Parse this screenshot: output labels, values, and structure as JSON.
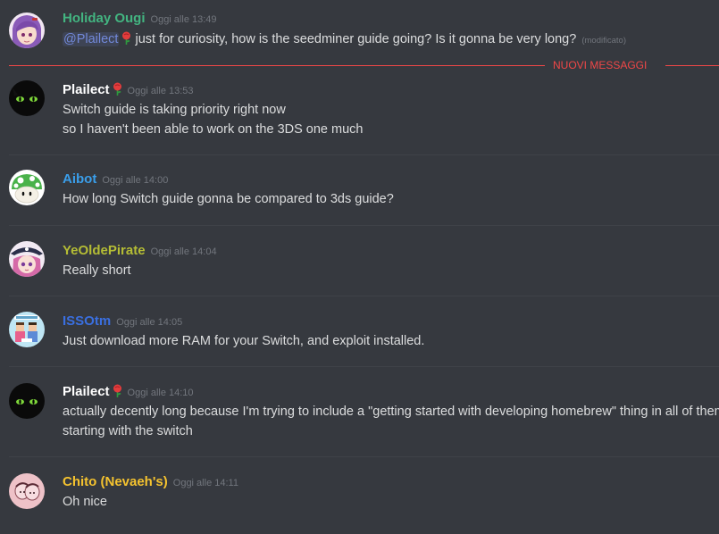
{
  "new_messages_label": "NUOVI MESSAGGI",
  "colors": {
    "background": "#36393f",
    "text": "#dcddde",
    "timestamp": "#72767d",
    "mention": "#7289da",
    "new_messages": "#f04747"
  },
  "messages": [
    {
      "author": "Holiday Ougi",
      "author_color": "#43b581",
      "timestamp": "Oggi alle 13:49",
      "avatar_icon": "purple-hair-anime-girl-avatar",
      "mention": "@Plailect",
      "mention_badge_icon": "rose-icon",
      "text": "just for curiosity, how is the seedminer guide going? Is it gonna  be very long?",
      "edited": "(modificato)"
    },
    {
      "author": "Plailect",
      "author_color": "#ffffff",
      "author_badge_icon": "rose-icon",
      "timestamp": "Oggi alle 13:53",
      "avatar_icon": "black-cat-avatar",
      "lines": [
        "Switch guide is taking priority right now",
        "so I haven't been able to work on the 3DS one much"
      ]
    },
    {
      "author": "Aibot",
      "author_color": "#3a9eea",
      "timestamp": "Oggi alle 14:00",
      "avatar_icon": "green-mushroom-avatar",
      "lines": [
        "How long Switch guide gonna be compared to 3ds guide?"
      ]
    },
    {
      "author": "YeOldePirate",
      "author_color": "#b5bd35",
      "timestamp": "Oggi alle 14:04",
      "avatar_icon": "pirate-anime-girl-avatar",
      "lines": [
        "Really short"
      ]
    },
    {
      "author": "ISSOtm",
      "author_color": "#3a6fe0",
      "timestamp": "Oggi alle 14:05",
      "avatar_icon": "pixel-art-people-avatar",
      "lines": [
        "Just download more RAM for your Switch, and exploit installed."
      ]
    },
    {
      "author": "Plailect",
      "author_color": "#ffffff",
      "author_badge_icon": "rose-icon",
      "timestamp": "Oggi alle 14:10",
      "avatar_icon": "black-cat-avatar",
      "lines": [
        "actually decently long because I'm trying to include a \"getting started with developing homebrew\" thing in all of them",
        "starting with the switch"
      ]
    },
    {
      "author": "Chito (Nevaeh's)",
      "author_color": "#f5c32f",
      "timestamp": "Oggi alle 14:11",
      "avatar_icon": "pink-sketch-avatar",
      "lines": [
        "Oh nice"
      ]
    }
  ]
}
